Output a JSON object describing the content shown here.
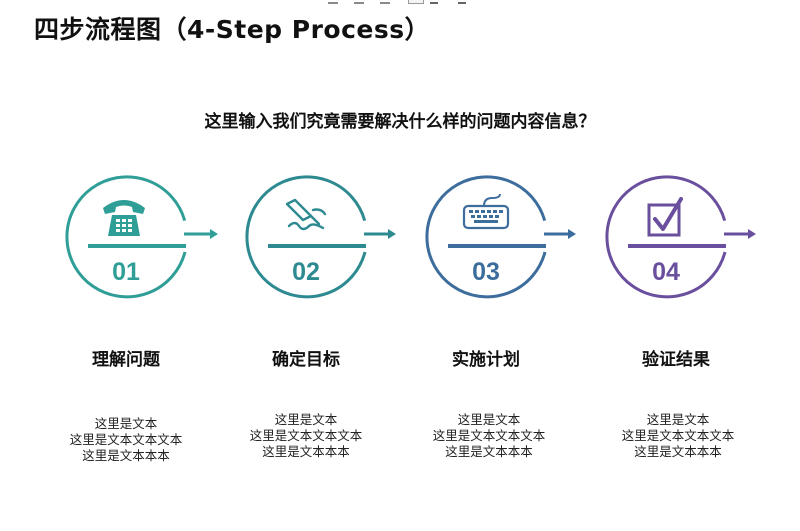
{
  "title": "四步流程图（4-Step Process）",
  "question": "这里输入我们究竟需要解决什么样的问题内容信息？",
  "steps": [
    {
      "number": "01",
      "title": "理解问题",
      "icon": "telephone-icon",
      "color": "#2e9e97",
      "lines": [
        "这里是文本",
        "这里是文本文本文本",
        "这里是文本本本"
      ]
    },
    {
      "number": "02",
      "title": "确定目标",
      "icon": "pen-writing-icon",
      "color": "#2d8a90",
      "lines": [
        "这里是文本",
        "这里是文本文本文本",
        "这里是文本本本"
      ]
    },
    {
      "number": "03",
      "title": "实施计划",
      "icon": "keyboard-icon",
      "color": "#3d6d9c",
      "lines": [
        "这里是文本",
        "这里是文本文本文本",
        "这里是文本本本"
      ]
    },
    {
      "number": "04",
      "title": "验证结果",
      "icon": "checkbox-icon",
      "color": "#6a4f9e",
      "lines": [
        "这里是文本",
        "这里是文本文本文本",
        "这里是文本本本"
      ]
    }
  ]
}
